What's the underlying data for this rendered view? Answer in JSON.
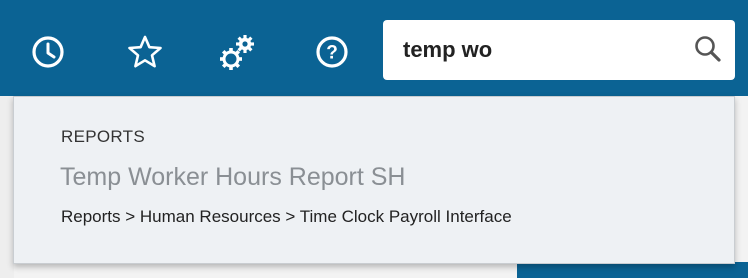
{
  "colors": {
    "topbar_bg": "#0b6394",
    "dropdown_bg": "#eef1f4",
    "result_title": "#8a8f94"
  },
  "toolbar": {
    "icons": [
      {
        "name": "history-icon"
      },
      {
        "name": "star-icon"
      },
      {
        "name": "gears-icon"
      },
      {
        "name": "help-icon"
      }
    ]
  },
  "search": {
    "value": "temp wo",
    "icon": "search-icon"
  },
  "dropdown": {
    "section_heading": "REPORTS",
    "results": [
      {
        "title": "Temp Worker Hours Report SH",
        "path": "Reports > Human Resources > Time Clock Payroll Interface"
      }
    ]
  }
}
